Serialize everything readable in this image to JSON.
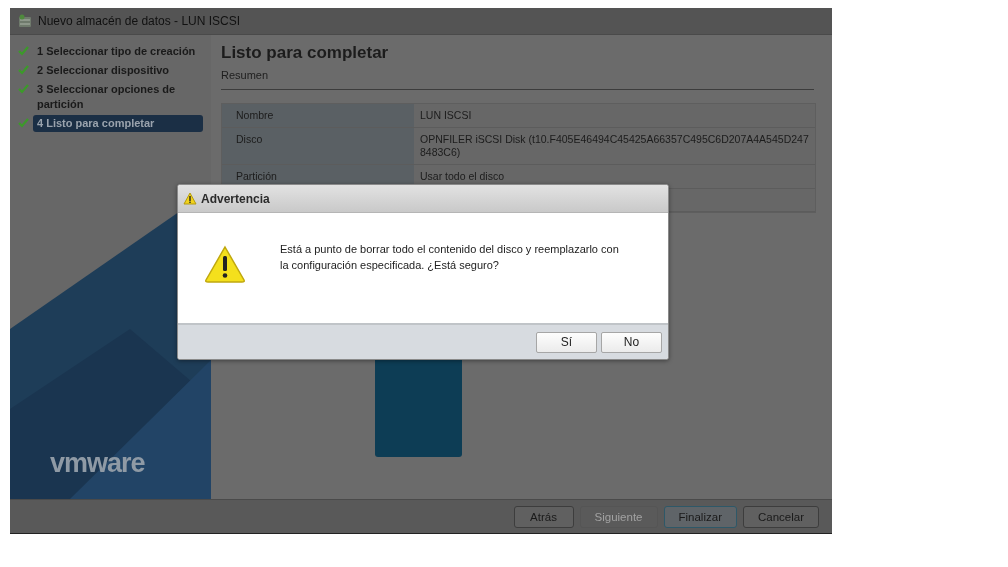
{
  "window": {
    "title": "Nuevo almacén de datos - LUN ISCSI"
  },
  "steps": [
    {
      "label": "1 Seleccionar tipo de creación",
      "done": true,
      "selected": false
    },
    {
      "label": "2 Seleccionar dispositivo",
      "done": true,
      "selected": false
    },
    {
      "label": "3 Seleccionar opciones de partición",
      "done": true,
      "selected": false
    },
    {
      "label": "4 Listo para completar",
      "done": true,
      "selected": true
    }
  ],
  "logo": "vmware",
  "page": {
    "title": "Listo para completar",
    "subtitle": "Resumen"
  },
  "summary": [
    {
      "label": "Nombre",
      "value": "LUN ISCSI"
    },
    {
      "label": "Disco",
      "value": "OPNFILER iSCSI Disk (t10.F405E46494C45425A66357C495C6D207A4A545D2478483C6)"
    },
    {
      "label": "Partición",
      "value": "Usar todo el disco"
    }
  ],
  "footer_buttons": [
    {
      "label": "Atrás",
      "disabled": false,
      "default": false
    },
    {
      "label": "Siguiente",
      "disabled": true,
      "default": false
    },
    {
      "label": "Finalizar",
      "disabled": false,
      "default": true
    },
    {
      "label": "Cancelar",
      "disabled": false,
      "default": false
    }
  ],
  "dialog": {
    "title": "Advertencia",
    "message": "Está a punto de borrar todo el contenido del disco y reemplazarlo con la configuración especificada. ¿Está seguro?",
    "buttons": [
      "Sí",
      "No"
    ]
  }
}
